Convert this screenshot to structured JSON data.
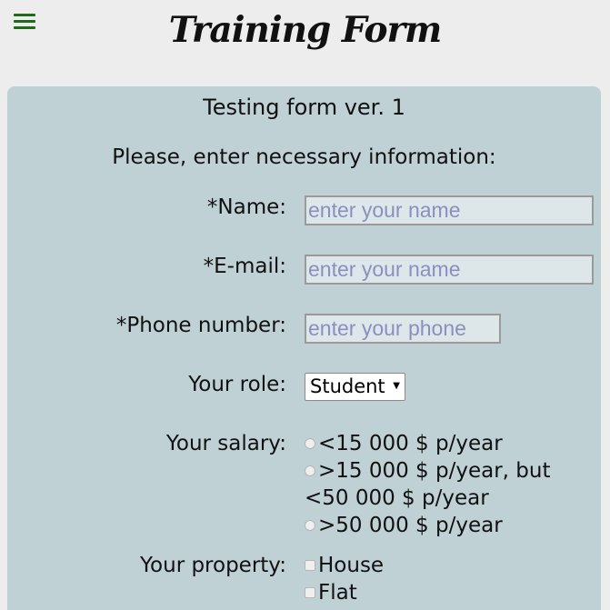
{
  "header": {
    "title": "Training Form",
    "menu_icon": "hamburger-menu-icon"
  },
  "form": {
    "title": "Testing form ver. 1",
    "intro": "Please, enter necessary information:",
    "name_label": "*Name:",
    "name_placeholder": "enter your name",
    "email_label": "*E-mail:",
    "email_placeholder": "enter your name",
    "phone_label": "*Phone number:",
    "phone_placeholder": "enter your phone",
    "role_label": "Your role:",
    "role_selected": "Student",
    "salary_label": "Your salary:",
    "salary_options": [
      "<15 000 $ p/year",
      ">15 000 $ p/year, but",
      "<50 000 $ p/year",
      ">50 000 $ p/year"
    ],
    "property_label": "Your property:",
    "property_options": [
      "House",
      "Flat"
    ]
  },
  "colors": {
    "background": "#eeeded",
    "panel": "#bfd1d5",
    "menu_icon": "#1f6b17",
    "placeholder": "#8b8fc0"
  }
}
